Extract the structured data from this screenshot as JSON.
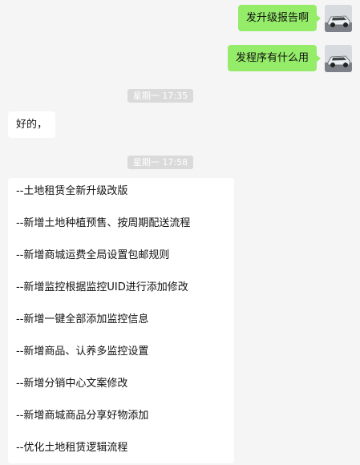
{
  "messages": {
    "out_1": "发升级报告啊",
    "out_2": "发程序有什么用",
    "time_1": "星期一 17:35",
    "in_short": "好的，",
    "time_2": "星期一 17:58",
    "in_long_lines": [
      "--土地租赁全新升级改版",
      "--新增土地种植预售、按周期配送流程",
      "--新增商城运费全局设置包邮规则",
      "--新增监控根据监控UID进行添加修改",
      "--新增一键全部添加监控信息",
      "--新增商品、认养多监控设置",
      "--新增分销中心文案修改",
      "--新增商城商品分享好物添加",
      "--优化土地租赁逻辑流程"
    ]
  },
  "colors": {
    "background": "#f5f5f5",
    "outgoing_bubble": "#95ec69",
    "incoming_bubble": "#ffffff",
    "timestamp_bg": "#dadada"
  },
  "icons": {
    "avatar": "car-photo-avatar-icon"
  }
}
